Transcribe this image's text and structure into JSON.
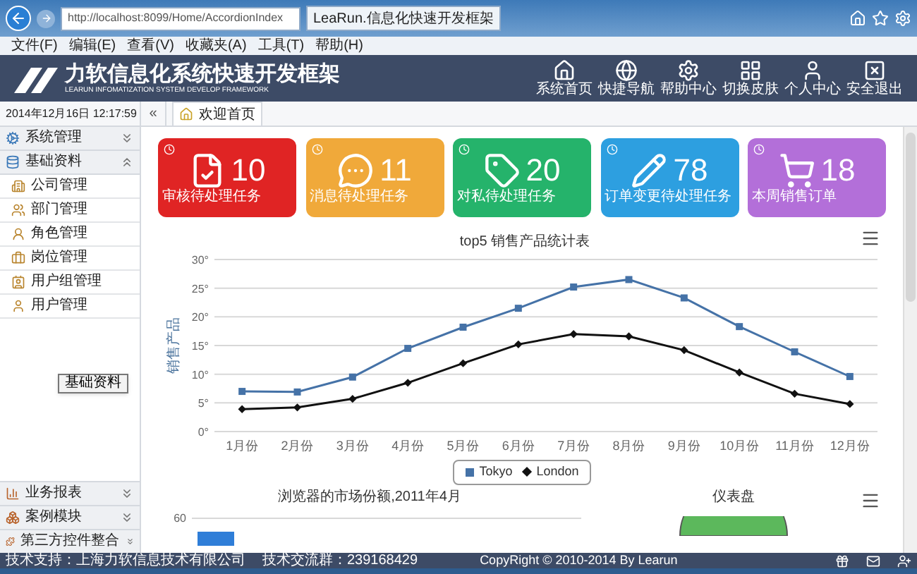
{
  "browser": {
    "address": "http://localhost:8099/Home/AccordionIndex",
    "tab_title": "LeaRun.信息化快速开发框架",
    "menu": [
      "文件(F)",
      "编辑(E)",
      "查看(V)",
      "收藏夹(A)",
      "工具(T)",
      "帮助(H)"
    ]
  },
  "header": {
    "title": "力软信息化系统快速开发框架",
    "subtitle": "LEARUN INFOMATIZATION SYSTEM DEVELOP FRAMEWORK",
    "nav": [
      "系统首页",
      "快捷导航",
      "帮助中心",
      "切换皮肤",
      "个人中心",
      "安全退出"
    ]
  },
  "datetime": "2014年12月16日 12:17:59",
  "collapse_symbol": "«",
  "tabs": [
    {
      "label": "欢迎首页",
      "selected": true
    }
  ],
  "sidebar": {
    "top_groups": [
      {
        "label": "系统管理",
        "expanded": false
      },
      {
        "label": "基础资料",
        "expanded": true,
        "children": [
          {
            "label": "公司管理"
          },
          {
            "label": "部门管理"
          },
          {
            "label": "角色管理"
          },
          {
            "label": "岗位管理"
          },
          {
            "label": "用户组管理"
          },
          {
            "label": "用户管理"
          }
        ]
      }
    ],
    "tooltip": "基础资料",
    "bottom_groups": [
      {
        "label": "业务报表",
        "expanded": false
      },
      {
        "label": "案例模块",
        "expanded": false
      },
      {
        "label": "第三方控件整合",
        "expanded": false
      }
    ]
  },
  "cards": [
    {
      "count": "10",
      "label": "审核待处理任务",
      "color": "#e02424"
    },
    {
      "count": "11",
      "label": "消息待处理任务",
      "color": "#f0a93a"
    },
    {
      "count": "20",
      "label": "对私待处理任务",
      "color": "#25b36b"
    },
    {
      "count": "78",
      "label": "订单变更待处理任务",
      "color": "#2d9fe0"
    },
    {
      "count": "18",
      "label": "本周销售订单",
      "color": "#b36fd9"
    }
  ],
  "chart_data": {
    "type": "line",
    "title": "top5 销售产品统计表",
    "ylabel": "销售产品",
    "categories": [
      "1月份",
      "2月份",
      "3月份",
      "4月份",
      "5月份",
      "6月份",
      "7月份",
      "8月份",
      "9月份",
      "10月份",
      "11月份",
      "12月份"
    ],
    "ylim": [
      0,
      30
    ],
    "grid": true,
    "legend": true,
    "yticks": [
      {
        "value": 0,
        "label": "0°"
      },
      {
        "value": 5,
        "label": "5°"
      },
      {
        "value": 10,
        "label": "10°"
      },
      {
        "value": 15,
        "label": "15°"
      },
      {
        "value": 20,
        "label": "20°"
      },
      {
        "value": 25,
        "label": "25°"
      },
      {
        "value": 30,
        "label": "30°"
      }
    ],
    "series": [
      {
        "name": "Tokyo",
        "color": "#4572a7",
        "marker": "square",
        "values": [
          7.0,
          6.9,
          9.5,
          14.5,
          18.2,
          21.5,
          25.2,
          26.5,
          23.3,
          18.3,
          13.9,
          9.6
        ]
      },
      {
        "name": "London",
        "color": "#111111",
        "marker": "diamond",
        "values": [
          3.9,
          4.2,
          5.7,
          8.5,
          11.9,
          15.2,
          17.0,
          16.6,
          14.2,
          10.3,
          6.6,
          4.8
        ]
      }
    ]
  },
  "lower_charts": [
    {
      "title": "浏览器的市场份额,2011年4月",
      "tick": "60"
    },
    {
      "title": "仪表盘"
    }
  ],
  "footer": {
    "support": "技术支持：上海力软信息技术有限公司",
    "group": "技术交流群：239168429",
    "copyright": "CopyRight © 2010-2014 By Learun"
  }
}
